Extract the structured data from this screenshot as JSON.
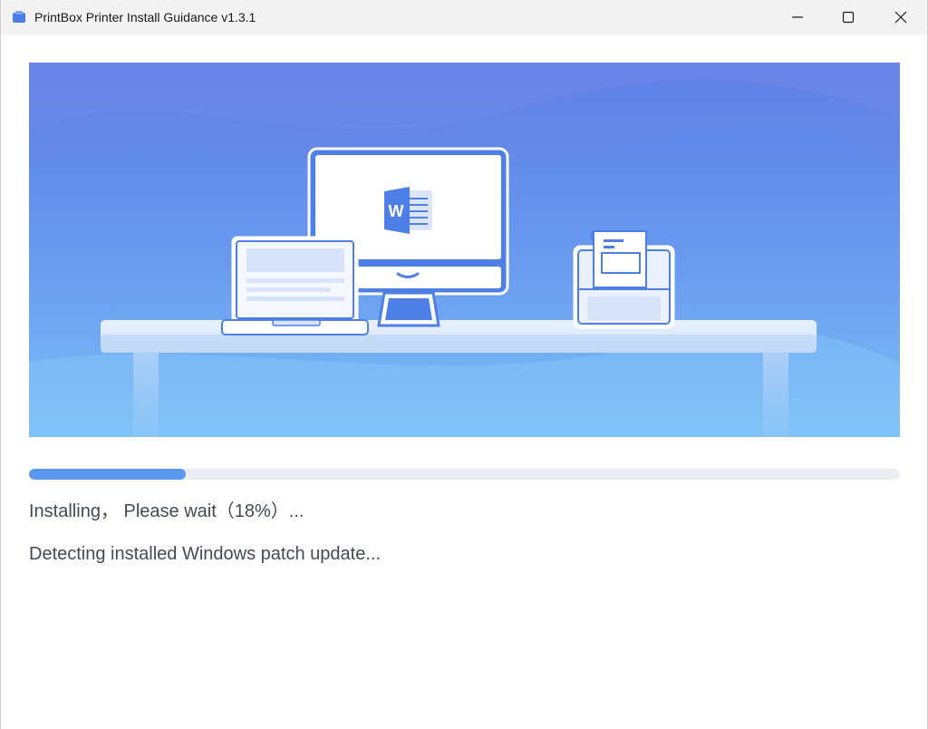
{
  "window": {
    "title": "PrintBox Printer Install Guidance v1.3.1",
    "app_icon": "printbox-app-icon",
    "controls": {
      "minimize_icon": "minimize-icon",
      "maximize_icon": "maximize-icon",
      "close_icon": "close-icon"
    }
  },
  "hero": {
    "illustration": "desk-with-laptop-monitor-printer",
    "monitor_icon": "word-document-icon",
    "monitor_icon_letter": "W",
    "colors": {
      "gradient_top": "#5b7fe6",
      "gradient_bottom": "#7cbcf6"
    }
  },
  "progress": {
    "percent": 18,
    "fill_color": "#5b97ee",
    "track_color": "#eaedf2"
  },
  "status": {
    "text": "Installing， Please wait（18%）...",
    "detail": "Detecting installed Windows patch update..."
  }
}
